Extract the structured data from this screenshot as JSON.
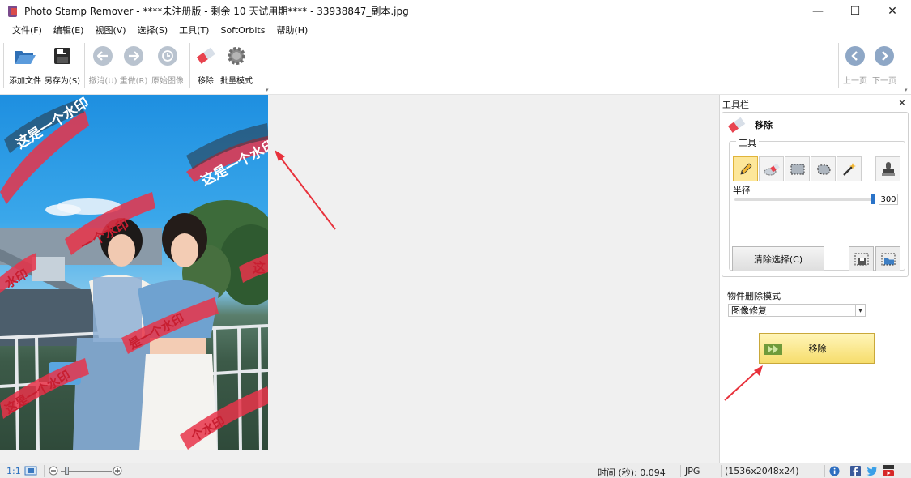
{
  "titlebar": {
    "title": "Photo Stamp Remover - ****未注册版 - 剩余 10 天试用期**** - 33938847_副本.jpg",
    "minimize": "—",
    "maximize": "☐",
    "close": "✕"
  },
  "menu": {
    "items": [
      "文件(F)",
      "编辑(E)",
      "视图(V)",
      "选择(S)",
      "工具(T)",
      "SoftOrbits",
      "帮助(H)"
    ]
  },
  "toolbar": {
    "add_file": "添加文件",
    "save_as": "另存为(S)",
    "undo": "撤消(U)",
    "redo": "重做(R)",
    "original": "原始图像",
    "remove": "移除",
    "batch": "批量模式",
    "prev_page": "上一页",
    "next_page": "下一页"
  },
  "photo": {
    "watermark_text": "这是一个水印",
    "watermark_partial_1": "一个水印",
    "watermark_partial_2": "这",
    "watermark_partial_3": "水印",
    "watermark_partial_4": "是一个水印",
    "watermark_partial_5": "这是一个水印",
    "watermark_partial_6": "个水印",
    "watermark_color": "#e8344a"
  },
  "panel": {
    "title": "工具栏",
    "close": "✕",
    "header": "移除",
    "tools_label": "工具",
    "radius_label": "半径",
    "radius_value": "300",
    "radius_fraction": 1.0,
    "clear_selection": "清除选择(C)",
    "mode_label": "物件删除模式",
    "mode_value": "图像修复",
    "remove_button": "移除"
  },
  "statusbar": {
    "zoom_ratio": "1:1",
    "time": "时间 (秒): 0.094",
    "format": "JPG",
    "dimensions": "(1536x2048x24)"
  },
  "colors": {
    "accent": "#2a73c8",
    "arrow": "#e8323c",
    "remove_button": "#f6dd6c"
  }
}
